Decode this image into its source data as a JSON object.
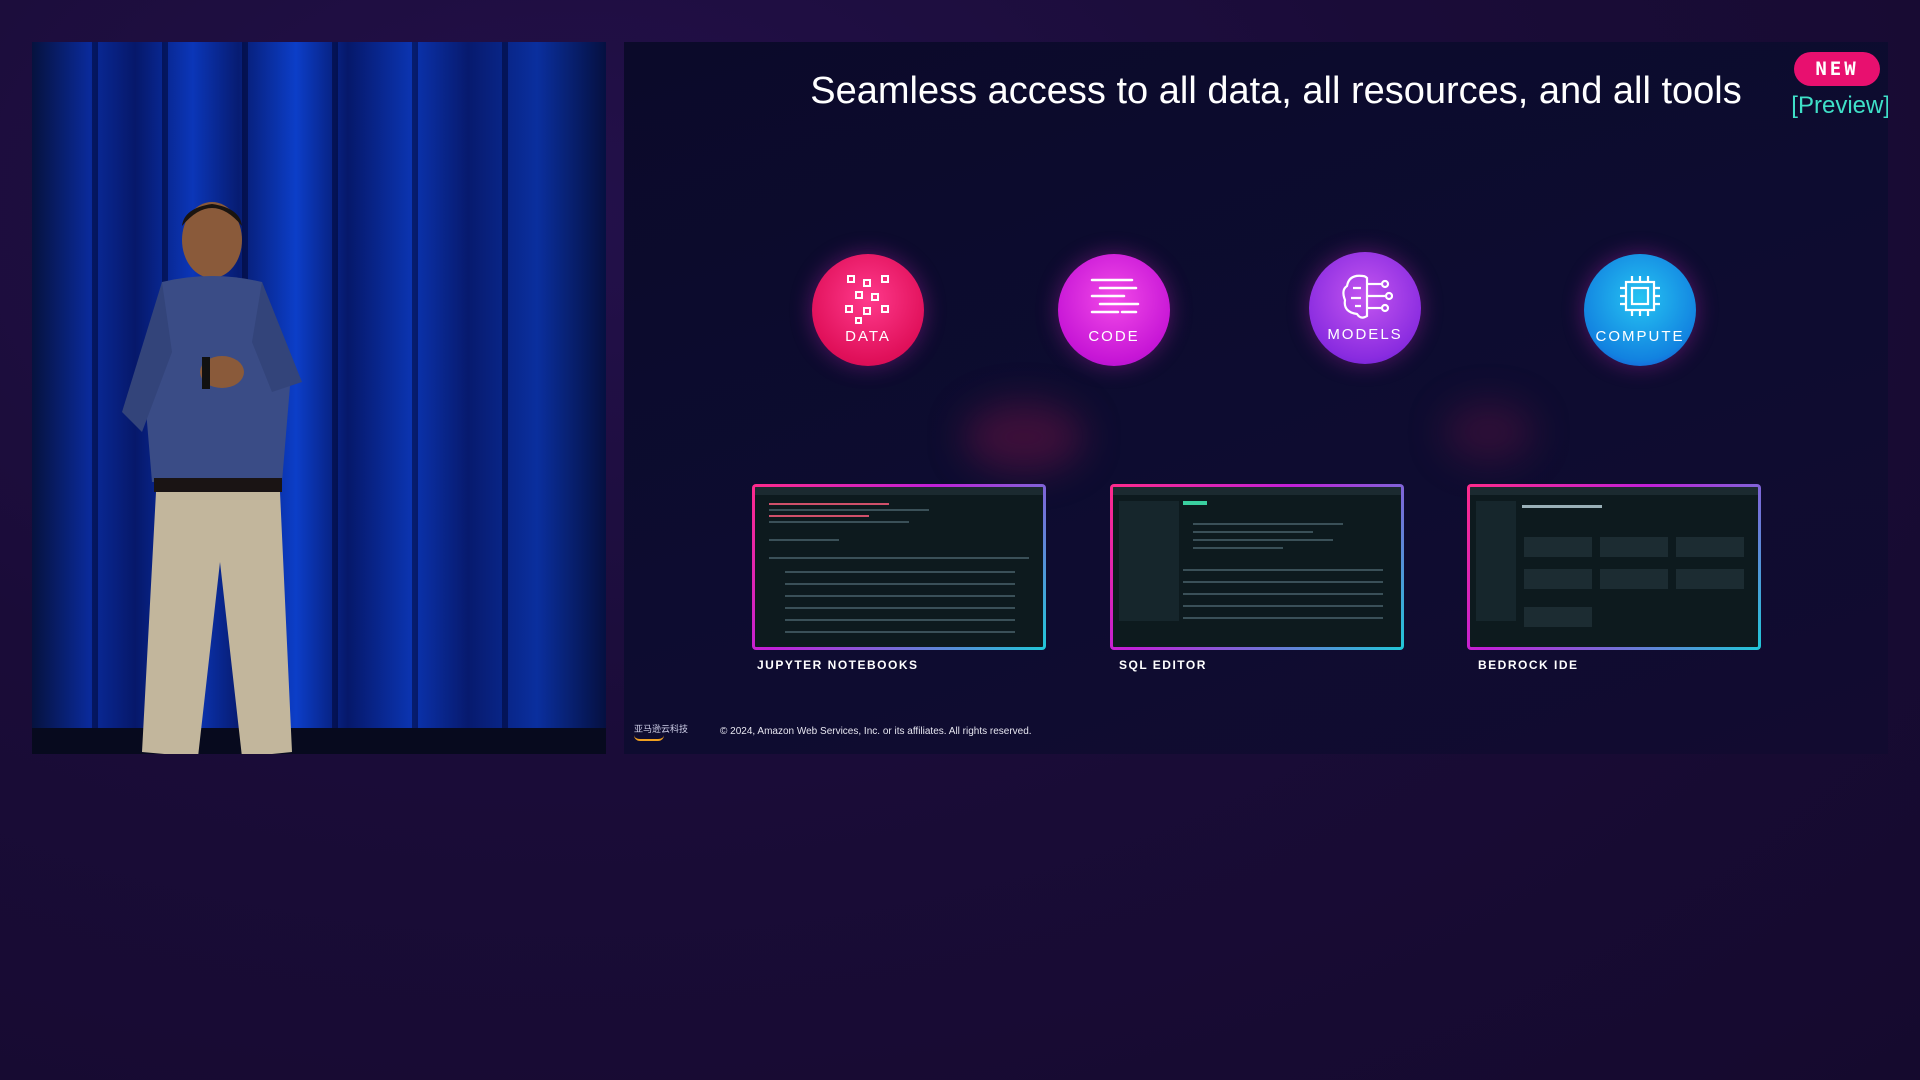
{
  "slide": {
    "title": "Seamless access to all data, all resources, and all tools",
    "badge": "NEW",
    "preview": "[Preview]",
    "pillars": [
      {
        "label": "DATA",
        "icon": "data-grid-icon"
      },
      {
        "label": "CODE",
        "icon": "code-lines-icon"
      },
      {
        "label": "MODELS",
        "icon": "brain-circuit-icon"
      },
      {
        "label": "COMPUTE",
        "icon": "chip-icon"
      }
    ],
    "tools": [
      {
        "label": "JUPYTER NOTEBOOKS"
      },
      {
        "label": "SQL EDITOR"
      },
      {
        "label": "BEDROCK IDE"
      }
    ],
    "footer_logo": "亚马逊云科技",
    "copyright": "© 2024, Amazon Web Services, Inc. or its affiliates. All rights reserved."
  },
  "colors": {
    "background": "#1a0c38",
    "badge": "#e8106f",
    "preview": "#3fe0c8",
    "data": "#e0105a",
    "code": "#c716d6",
    "models": "#8a2ce0",
    "compute": "#1282e0"
  }
}
